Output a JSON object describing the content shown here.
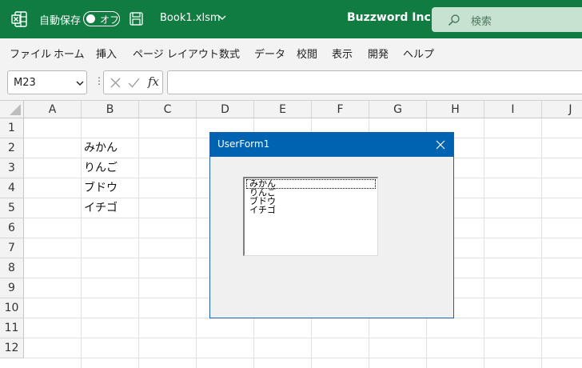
{
  "window": {
    "autosave_label": "自動保存",
    "autosave_state": "オフ",
    "filename": "Book1.xlsm",
    "company": "Buzzword Inc.",
    "search_placeholder": "検索",
    "brand_color": "#107c41"
  },
  "menu": {
    "items": [
      "ファイル",
      "ホーム",
      "挿入",
      "ページ レイアウト",
      "数式",
      "データ",
      "校閲",
      "表示",
      "開発",
      "ヘルプ"
    ]
  },
  "formula_bar": {
    "name_box": "M23",
    "dots": "⋮",
    "fx": "fx",
    "formula": ""
  },
  "sheet": {
    "columns": [
      "A",
      "B",
      "C",
      "D",
      "E",
      "F",
      "G",
      "H",
      "I",
      "J"
    ],
    "rows": [
      "1",
      "2",
      "3",
      "4",
      "5",
      "6",
      "7",
      "8",
      "9",
      "10",
      "11",
      "12"
    ],
    "cells": {
      "B2": "みかん",
      "B3": "りんご",
      "B4": "ブドウ",
      "B5": "イチゴ"
    }
  },
  "userform": {
    "title": "UserForm1",
    "title_color": "#0063b1",
    "listbox_items": [
      "みかん",
      "りんご",
      "ブドウ",
      "イチゴ"
    ]
  }
}
